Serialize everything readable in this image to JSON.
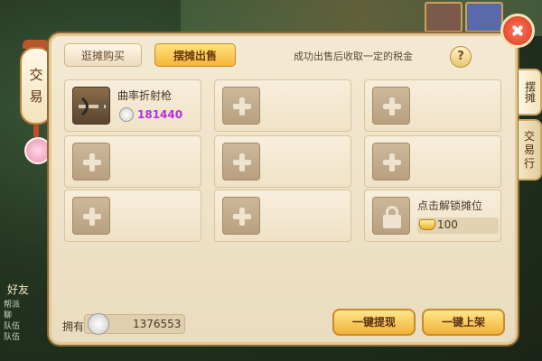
{
  "window": {
    "title_chars": [
      "交",
      "易"
    ]
  },
  "tabs": {
    "browse_buy": "逛摊购买",
    "stall_sell": "摆摊出售"
  },
  "tax_note": "成功出售后收取一定的税金",
  "help_label": "?",
  "side_tabs": {
    "stall": "摆摊",
    "trade_house": [
      "交",
      "易",
      "行"
    ]
  },
  "listed_item": {
    "name": "曲率折射枪",
    "price": "181440"
  },
  "locked_slot": {
    "label": "点击解锁摊位",
    "cost": "100"
  },
  "balance": {
    "label": "拥有",
    "value": "1376553"
  },
  "buttons": {
    "withdraw": "一键提现",
    "list_all": "一键上架"
  },
  "background": {
    "friend_label": "好友",
    "chat_lines": [
      "帮派",
      "聊",
      "队伍",
      "队伍"
    ]
  },
  "colors": {
    "price_purple": "#b62ee0",
    "gold_button": "#f2b23a",
    "close_red": "#d8391f"
  }
}
